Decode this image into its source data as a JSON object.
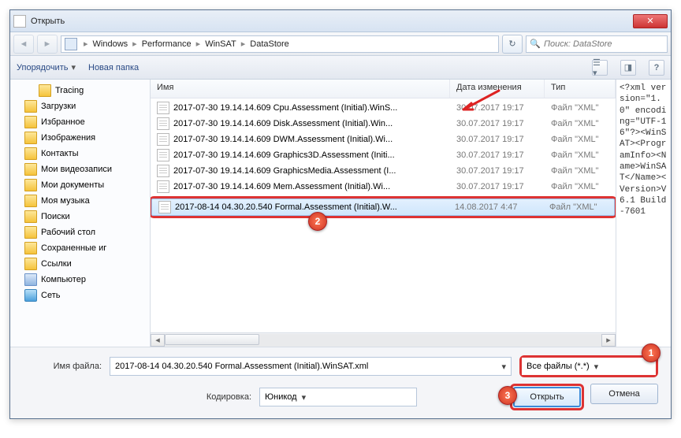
{
  "title": "Открыть",
  "nav": {
    "crumbs": [
      "Windows",
      "Performance",
      "WinSAT",
      "DataStore"
    ],
    "search_placeholder": "Поиск: DataStore"
  },
  "toolbar": {
    "organize": "Упорядочить",
    "newfolder": "Новая папка"
  },
  "tree": [
    {
      "icon": "folder",
      "label": "Tracing",
      "sub": true
    },
    {
      "icon": "folder",
      "label": "Загрузки"
    },
    {
      "icon": "folder",
      "label": "Избранное"
    },
    {
      "icon": "folder",
      "label": "Изображения"
    },
    {
      "icon": "folder",
      "label": "Контакты"
    },
    {
      "icon": "folder",
      "label": "Мои видеозаписи"
    },
    {
      "icon": "folder",
      "label": "Мои документы"
    },
    {
      "icon": "folder",
      "label": "Моя музыка"
    },
    {
      "icon": "folder",
      "label": "Поиски"
    },
    {
      "icon": "folder",
      "label": "Рабочий стол"
    },
    {
      "icon": "folder",
      "label": "Сохраненные иг"
    },
    {
      "icon": "folder",
      "label": "Ссылки"
    },
    {
      "icon": "computer",
      "label": "Компьютер"
    },
    {
      "icon": "network",
      "label": "Сеть"
    }
  ],
  "columns": {
    "name": "Имя",
    "date": "Дата изменения",
    "type": "Тип"
  },
  "files": [
    {
      "name": "2017-07-30 19.14.14.609 Cpu.Assessment (Initial).WinS...",
      "date": "30.07.2017 19:17",
      "type": "Файл \"XML\""
    },
    {
      "name": "2017-07-30 19.14.14.609 Disk.Assessment (Initial).Win...",
      "date": "30.07.2017 19:17",
      "type": "Файл \"XML\""
    },
    {
      "name": "2017-07-30 19.14.14.609 DWM.Assessment (Initial).Wi...",
      "date": "30.07.2017 19:17",
      "type": "Файл \"XML\""
    },
    {
      "name": "2017-07-30 19.14.14.609 Graphics3D.Assessment (Initi...",
      "date": "30.07.2017 19:17",
      "type": "Файл \"XML\""
    },
    {
      "name": "2017-07-30 19.14.14.609 GraphicsMedia.Assessment (I...",
      "date": "30.07.2017 19:17",
      "type": "Файл \"XML\""
    },
    {
      "name": "2017-07-30 19.14.14.609 Mem.Assessment (Initial).Wi...",
      "date": "30.07.2017 19:17",
      "type": "Файл \"XML\""
    },
    {
      "name": "2017-08-14 04.30.20.540 Formal.Assessment (Initial).W...",
      "date": "14.08.2017 4:47",
      "type": "Файл \"XML\"",
      "selected": true
    }
  ],
  "preview": "<?xml version=\"1.0\" encoding=\"UTF-16\"?><WinSAT><ProgramInfo><Name>WinSAT</Name><Version>V6.1 Build-7601",
  "footer": {
    "filename_label": "Имя файла:",
    "filename_value": "2017-08-14 04.30.20.540 Formal.Assessment (Initial).WinSAT.xml",
    "filter": "Все файлы (*.*)",
    "encoding_label": "Кодировка:",
    "encoding_value": "Юникод",
    "open": "Открыть",
    "cancel": "Отмена"
  },
  "annotations": {
    "b1": "1",
    "b2": "2",
    "b3": "3"
  }
}
